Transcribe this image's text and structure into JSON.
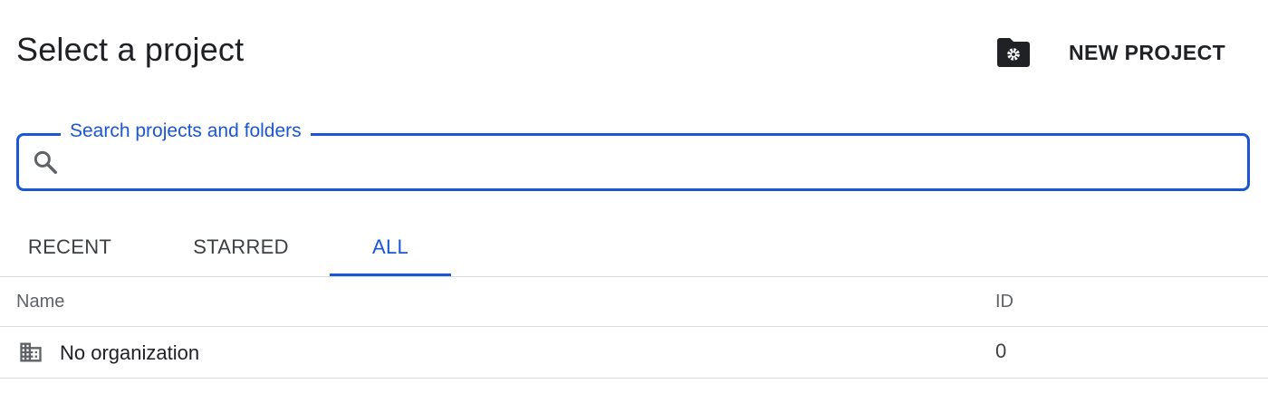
{
  "header": {
    "title": "Select a project",
    "new_project_label": "NEW PROJECT",
    "folder_settings_icon": "folder-gear-icon"
  },
  "search": {
    "label": "Search projects and folders",
    "value": "",
    "placeholder": "",
    "icon": "search-icon"
  },
  "tabs": [
    {
      "label": "RECENT",
      "active": false
    },
    {
      "label": "STARRED",
      "active": false
    },
    {
      "label": "ALL",
      "active": true
    }
  ],
  "table": {
    "columns": [
      "Name",
      "ID"
    ],
    "rows": [
      {
        "icon": "organization-building-icon",
        "name": "No organization",
        "id": "0"
      }
    ]
  },
  "colors": {
    "accent": "#1a56d6",
    "text_primary": "#202124",
    "text_secondary": "#5f6368",
    "divider": "#dadce0"
  }
}
